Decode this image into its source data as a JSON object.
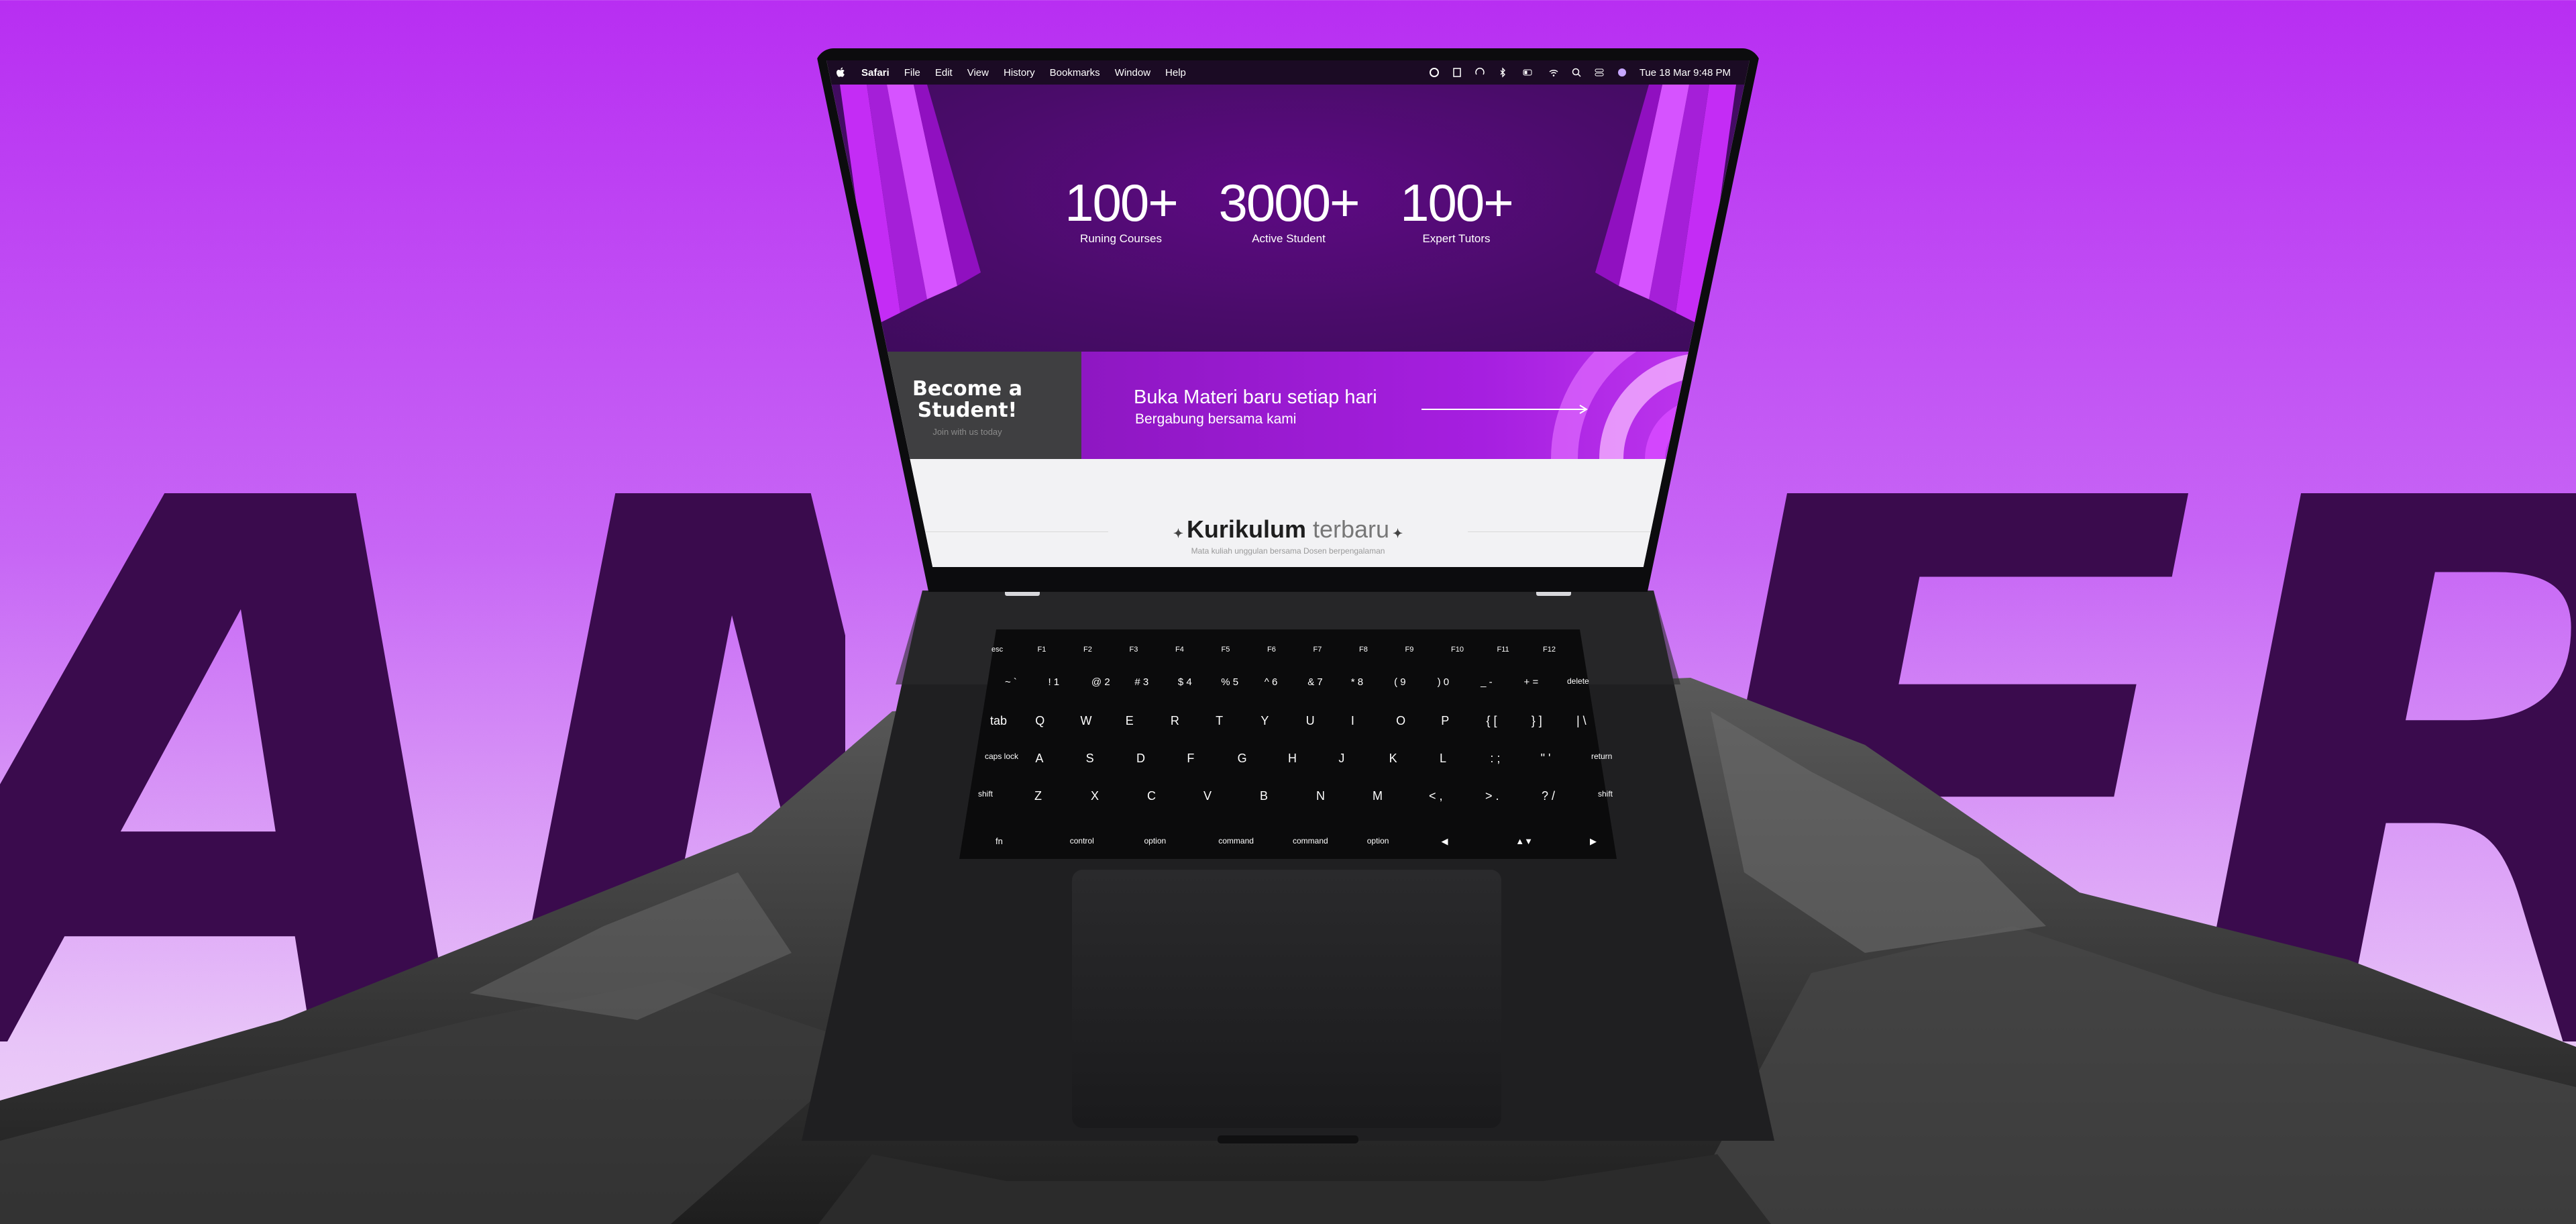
{
  "background": {
    "word_left": "AM",
    "word_right": "ERI",
    "colors": {
      "top": "#b82ef2",
      "bottom": "#f2dcf9",
      "letters": "#3a0b4d"
    }
  },
  "menubar": {
    "app": "Safari",
    "items": [
      "File",
      "Edit",
      "View",
      "History",
      "Bookmarks",
      "Window",
      "Help"
    ],
    "clock": "Tue 18 Mar  9:48 PM",
    "status_icons": [
      "circle-icon",
      "notes-icon",
      "airdrop-icon",
      "bluetooth-icon",
      "battery-icon",
      "wifi-icon",
      "search-icon",
      "control-center-icon",
      "siri-icon"
    ]
  },
  "hero": {
    "stats": [
      {
        "value": "100+",
        "label": "Runing Courses"
      },
      {
        "value": "3000+",
        "label": "Active Student"
      },
      {
        "value": "100+",
        "label": "Expert Tutors"
      }
    ]
  },
  "cta": {
    "title": "Become a Student!",
    "subtitle": "Join with us today",
    "banner_title": "Buka Materi baru setiap hari",
    "banner_subtitle": "Bergabung bersama kami"
  },
  "curriculum": {
    "title_bold": "Kurikulum",
    "title_muted": "terbaru",
    "subtitle": "Mata kuliah unggulan bersama Dosen berpengalaman"
  },
  "keyboard": {
    "row_fn": [
      "esc",
      "F1",
      "F2",
      "F3",
      "F4",
      "F5",
      "F6",
      "F7",
      "F8",
      "F9",
      "F10",
      "F11",
      "F12"
    ],
    "row_num": [
      "~ `",
      "! 1",
      "@ 2",
      "# 3",
      "$ 4",
      "% 5",
      "^ 6",
      "& 7",
      "* 8",
      "( 9",
      ") 0",
      "_ -",
      "+ =",
      "delete"
    ],
    "row_q": [
      "tab",
      "Q",
      "W",
      "E",
      "R",
      "T",
      "Y",
      "U",
      "I",
      "O",
      "P",
      "{ [",
      "} ]",
      "| \\"
    ],
    "row_a": [
      "caps lock",
      "A",
      "S",
      "D",
      "F",
      "G",
      "H",
      "J",
      "K",
      "L",
      ": ;",
      "\" '",
      "return"
    ],
    "row_z": [
      "shift",
      "Z",
      "X",
      "C",
      "V",
      "B",
      "N",
      "M",
      "< ,",
      "> .",
      "? /",
      "shift"
    ],
    "row_bottom": [
      "fn",
      "control",
      "option",
      "command",
      "command",
      "option",
      "◀",
      "▲▼",
      "▶"
    ]
  }
}
